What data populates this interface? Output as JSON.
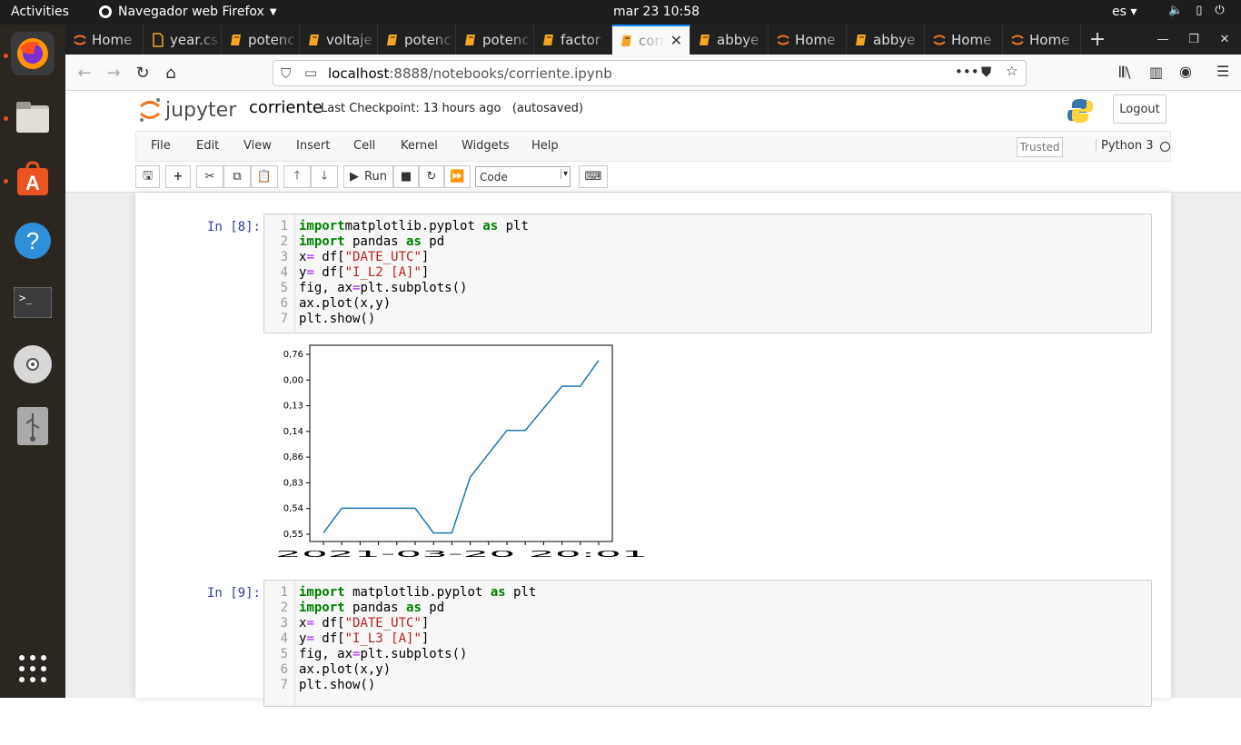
{
  "topbar": {
    "activities": "Activities",
    "app": "Navegador web Firefox",
    "clock": "mar 23  10:58",
    "lang": "es"
  },
  "tabs": [
    {
      "label": "Home",
      "icon": "jupyter-icon"
    },
    {
      "label": "year.cs",
      "icon": "file-icon"
    },
    {
      "label": "potenc",
      "icon": "notebook-icon"
    },
    {
      "label": "voltaje",
      "icon": "notebook-icon"
    },
    {
      "label": "potenc",
      "icon": "notebook-icon"
    },
    {
      "label": "potenc",
      "icon": "notebook-icon"
    },
    {
      "label": "factor",
      "icon": "notebook-icon"
    },
    {
      "label": "corr",
      "icon": "notebook-icon",
      "active": true
    },
    {
      "label": "abbye",
      "icon": "notebook-icon"
    },
    {
      "label": "Home",
      "icon": "jupyter-icon"
    },
    {
      "label": "abbye",
      "icon": "notebook-icon"
    },
    {
      "label": "Home",
      "icon": "jupyter-icon"
    },
    {
      "label": "Home",
      "icon": "jupyter-icon"
    }
  ],
  "url": {
    "host": "localhost",
    "rest": ":8888/notebooks/corriente.ipynb"
  },
  "jupyter": {
    "logo_text": "jupyter",
    "notebook_name": "corriente",
    "checkpoint": "Last Checkpoint: 13 hours ago",
    "autosaved": "(autosaved)",
    "logout": "Logout",
    "menus": [
      "File",
      "Edit",
      "View",
      "Insert",
      "Cell",
      "Kernel",
      "Widgets",
      "Help"
    ],
    "trusted": "Trusted",
    "kernel": "Python 3",
    "run_label": "Run",
    "cell_type": "Code"
  },
  "cells": [
    {
      "prompt": "In [8]:",
      "lines": [
        [
          [
            "kw",
            "import"
          ],
          [
            "",
            "matplotlib.pyplot "
          ],
          [
            "kw",
            "as"
          ],
          [
            "",
            " plt"
          ]
        ],
        [
          [
            "kw",
            "import"
          ],
          [
            "",
            " pandas "
          ],
          [
            "kw",
            "as"
          ],
          [
            "",
            " pd"
          ]
        ],
        [
          [
            "",
            "x"
          ],
          [
            "op",
            "="
          ],
          [
            "",
            " df["
          ],
          [
            "str",
            "\"DATE_UTC\""
          ],
          [
            "",
            "]"
          ]
        ],
        [
          [
            "",
            "y"
          ],
          [
            "op",
            "="
          ],
          [
            "",
            " df["
          ],
          [
            "str",
            "\"I_L2 [A]\""
          ],
          [
            "",
            "]"
          ]
        ],
        [
          [
            "",
            "fig, ax"
          ],
          [
            "op",
            "="
          ],
          [
            "",
            "plt.subplots()"
          ]
        ],
        [
          [
            "",
            "ax.plot(x,y)"
          ]
        ],
        [
          [
            "",
            "plt.show()"
          ]
        ]
      ]
    },
    {
      "prompt": "In [9]:",
      "lines": [
        [
          [
            "kw",
            "import"
          ],
          [
            "",
            " matplotlib.pyplot "
          ],
          [
            "kw",
            "as"
          ],
          [
            "",
            " plt"
          ]
        ],
        [
          [
            "kw",
            "import"
          ],
          [
            "",
            " pandas "
          ],
          [
            "kw",
            "as"
          ],
          [
            "",
            " pd"
          ]
        ],
        [
          [
            "",
            "x"
          ],
          [
            "op",
            "="
          ],
          [
            "",
            " df["
          ],
          [
            "str",
            "\"DATE_UTC\""
          ],
          [
            "",
            "]"
          ]
        ],
        [
          [
            "",
            "y"
          ],
          [
            "op",
            "="
          ],
          [
            "",
            " df["
          ],
          [
            "str",
            "\"I_L3 [A]\""
          ],
          [
            "",
            "]"
          ]
        ],
        [
          [
            "",
            "fig, ax"
          ],
          [
            "op",
            "="
          ],
          [
            "",
            "plt.subplots()"
          ]
        ],
        [
          [
            "",
            "ax.plot(x,y)"
          ]
        ],
        [
          [
            "",
            "plt.show()"
          ]
        ]
      ]
    }
  ],
  "chart_data": {
    "type": "line",
    "title": "",
    "xlabel": "",
    "ylabel": "",
    "y_ticks": [
      "0,76",
      "0,00",
      "0,13",
      "0,14",
      "0,86",
      "0,83",
      "0,54",
      "0,55"
    ],
    "x_tick_text": "2021-03-20 20:01",
    "x": [
      0,
      1,
      2,
      3,
      4,
      5,
      6,
      7,
      8,
      9,
      10,
      11,
      12,
      13,
      14,
      15
    ],
    "y_rank": [
      0.05,
      1,
      1,
      1,
      1,
      1,
      0.05,
      0.05,
      2.2,
      3.1,
      4,
      4,
      4.85,
      5.7,
      5.7,
      6.7
    ],
    "color": "#1f77b4"
  }
}
